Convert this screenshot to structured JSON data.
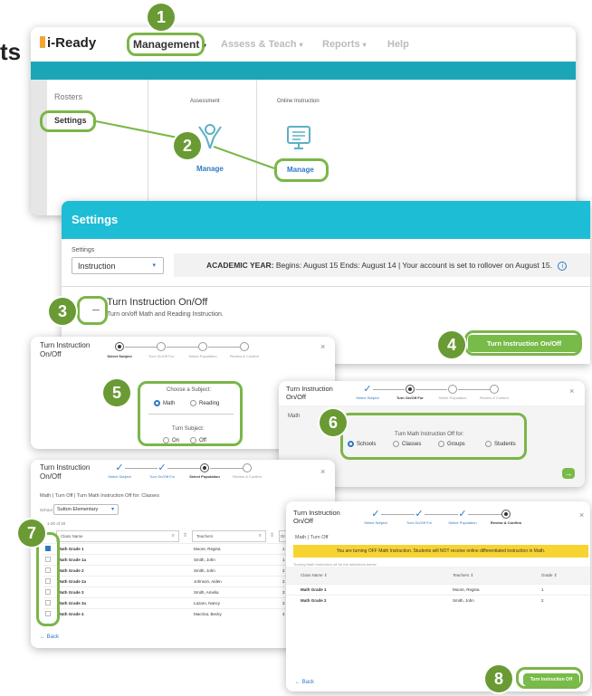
{
  "left_edge_fragment": "ts",
  "nav": {
    "logo": "i-Ready",
    "items": [
      "Management",
      "Assess & Teach",
      "Reports",
      "Help"
    ],
    "colors": {
      "teal": "#1aa6b7",
      "accent_green": "#7ab648"
    }
  },
  "mgmt_menu": {
    "sidebar": [
      "Rosters",
      "Settings"
    ],
    "columns": [
      {
        "title": "Assessment",
        "action": "Manage",
        "icon": "person-raising-arm-icon"
      },
      {
        "title": "Online Instruction",
        "action": "Manage",
        "icon": "monitor-icon"
      }
    ]
  },
  "settings": {
    "header": "Settings",
    "select_label": "Settings",
    "select_value": "Instruction",
    "academic_label": "ACADEMIC YEAR:",
    "academic_text": "Begins: August 15  Ends: August 14  |  Your account is set to rollover on August 15.",
    "toggle_title": "Turn Instruction On/Off",
    "toggle_desc": "Turn on/off Math and Reading Instruction.",
    "toggle_button": "Turn Instruction On/Off"
  },
  "wizard": {
    "title": "Turn Instruction On/Off",
    "steps": [
      "Select Subject",
      "Turn On/Off For",
      "Select Population",
      "Review & Confirm"
    ]
  },
  "subject": {
    "choose": "Choose a Subject:",
    "options": [
      "Math",
      "Reading"
    ],
    "turn_label": "Turn Subject:",
    "turn_options": [
      "On",
      "Off"
    ]
  },
  "for_panel": {
    "subject": "Math",
    "prompt": "Turn Math Instruction Off for:",
    "options": [
      "Schools",
      "Classes",
      "Groups",
      "Students"
    ]
  },
  "population": {
    "breadcrumb": "Math  |  Turn Off  |  Turn Math Instruction Off for: Classes",
    "school_label": "School",
    "school_value": "Sutton Elementary",
    "count": "1-20 of 20",
    "columns": [
      "Class Name",
      "Teachers",
      "Gr"
    ],
    "rows": [
      {
        "name": "Math Grade 1",
        "teacher": "Moore, Regina",
        "grade": "1"
      },
      {
        "name": "Math Grade 1a",
        "teacher": "Smith, John",
        "grade": "1"
      },
      {
        "name": "Math Grade 2",
        "teacher": "Smith, John",
        "grade": "2"
      },
      {
        "name": "Math Grade 2a",
        "teacher": "Johnson, Aiden",
        "grade": "2"
      },
      {
        "name": "Math Grade 3",
        "teacher": "Smith, Amelia",
        "grade": "3"
      },
      {
        "name": "Math Grade 3a",
        "teacher": "Lazaro, Nancy",
        "grade": "3"
      },
      {
        "name": "Math Grade 4",
        "teacher": "Macrina, Becky",
        "grade": "4"
      }
    ],
    "back": "Back"
  },
  "review": {
    "breadcrumb": "Math  |  Turn Off",
    "warning": "You are turning OFF Math Instruction. Students will NOT receive online differentiated instruction in Math.",
    "sub": "Turning Math Instruction off for the selections below:",
    "columns": [
      "Class Name",
      "Teachers",
      "Grade"
    ],
    "rows": [
      {
        "name": "Math Grade 1",
        "teacher": "Moore, Regina",
        "grade": "1"
      },
      {
        "name": "Math Grade 2",
        "teacher": "Smith, John",
        "grade": "2"
      }
    ],
    "back": "Back",
    "confirm": "Turn Instruction Off"
  },
  "badges": [
    "1",
    "2",
    "3",
    "4",
    "5",
    "6",
    "7",
    "8"
  ]
}
